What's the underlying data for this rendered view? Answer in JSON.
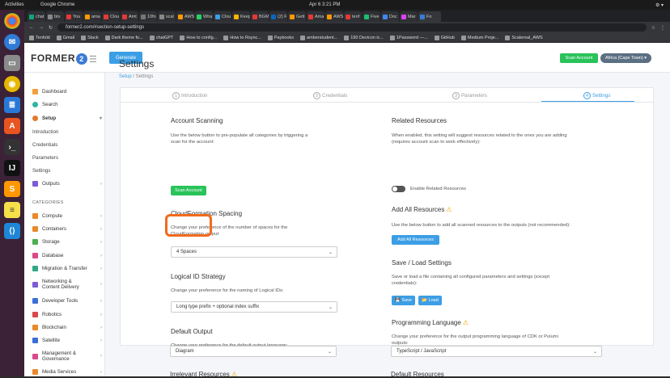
{
  "os": {
    "activities": "Activities",
    "app_name": "Google Chrome",
    "clock": "Apr 6  3:21 PM"
  },
  "browser": {
    "tabs": [
      "chat",
      "bts",
      "You",
      "ama",
      "Clou",
      "Amt",
      "10fo",
      "scal",
      "AWS",
      "Wha",
      "Clou",
      "Keep",
      "BGM",
      "(2) F",
      "Gett",
      "Ama",
      "AWS",
      "tenf",
      "Five",
      "Doc",
      "Mar",
      "Fo"
    ],
    "url": "former2.com/#section-setup-settings",
    "bookmarks": [
      "Tenfold",
      "Gmail",
      "Slack",
      "Dark theme fo...",
      "chatGPT",
      "How to config...",
      "How to Rsync...",
      "Paybooks",
      "amberstudent...",
      "190 Devicon ic...",
      "1Password —...",
      "GitHub",
      "Medium Proje...",
      "Scalereal_AWS"
    ]
  },
  "header": {
    "logo": "FORMER",
    "logo_num": "2",
    "generate_label": "Generate",
    "scan_account_label": "Scan Account",
    "region_label": "Africa (Cape Town) ▾"
  },
  "sidebar": {
    "dashboard": "Dashboard",
    "search": "Search",
    "setup": "Setup",
    "setup_items": [
      "Introduction",
      "Credentials",
      "Parameters",
      "Settings"
    ],
    "outputs": "Outputs",
    "categories_heading": "CATEGORIES",
    "categories": [
      "Compute",
      "Containers",
      "Storage",
      "Database",
      "Migration & Transfer",
      "Networking &",
      "Developer Tools",
      "Robotics",
      "Blockchain",
      "Satellite",
      "Management &",
      "Media Services"
    ],
    "networking_line2": "Content Delivery",
    "management_line2": "Governance"
  },
  "page": {
    "title": "Settings",
    "breadcrumb_link": "Setup",
    "breadcrumb_current": "Settings",
    "steps": [
      {
        "num": "1",
        "label": "Introduction"
      },
      {
        "num": "2",
        "label": "Credentials"
      },
      {
        "num": "3",
        "label": "Parameters"
      },
      {
        "num": "4",
        "label": "Settings"
      }
    ]
  },
  "left_col": {
    "account_scanning_title": "Account Scanning",
    "account_scanning_desc1": "Use the below button to pre-populate all categories by triggering a",
    "account_scanning_desc2": "scan for the account:",
    "scan_account_button": "Scan Account",
    "cfn_spacing_title": "CloudFormation Spacing",
    "cfn_spacing_desc1": "Change your preference of the number of spaces for the",
    "cfn_spacing_desc2": "CloudFormation output:",
    "cfn_spacing_value": "4 Spaces",
    "logical_id_title": "Logical ID Strategy",
    "logical_id_desc": "Change your preference for the naming of Logical IDs:",
    "logical_id_value": "Long type prefix + optional index suffix",
    "default_output_title": "Default Output",
    "default_output_desc": "Change your preference for the default output language:",
    "default_output_value": "Diagram",
    "irrelevant_title": "Irrelevant Resources"
  },
  "right_col": {
    "related_title": "Related Resources",
    "related_desc1": "When enabled, this setting will suggest resources related to the ones you are adding",
    "related_desc2": "(requires account scan to work effectively):",
    "related_toggle_label": "Enable Related Resources",
    "add_all_title": "Add All Resources",
    "add_all_desc": "Use the below button to add all scanned resources to the outputs (not recommended):",
    "add_all_button": "Add All Resources",
    "save_load_title": "Save / Load Settings",
    "save_load_desc1": "Save or load a file containing all configured parameters and settings (except",
    "save_load_desc2": "credentials):",
    "save_button": "Save",
    "load_button": "Load",
    "prog_lang_title": "Programming Language",
    "prog_lang_desc1": "Change your preference for the output programming language of CDK or Pulumi",
    "prog_lang_desc2": "outputs:",
    "prog_lang_value": "TypeScript / JavaScript",
    "default_resources_title": "Default Resources"
  },
  "colors": {
    "accent": "#3c9ee5",
    "green": "#29c35a",
    "highlight": "#f26a1b"
  }
}
